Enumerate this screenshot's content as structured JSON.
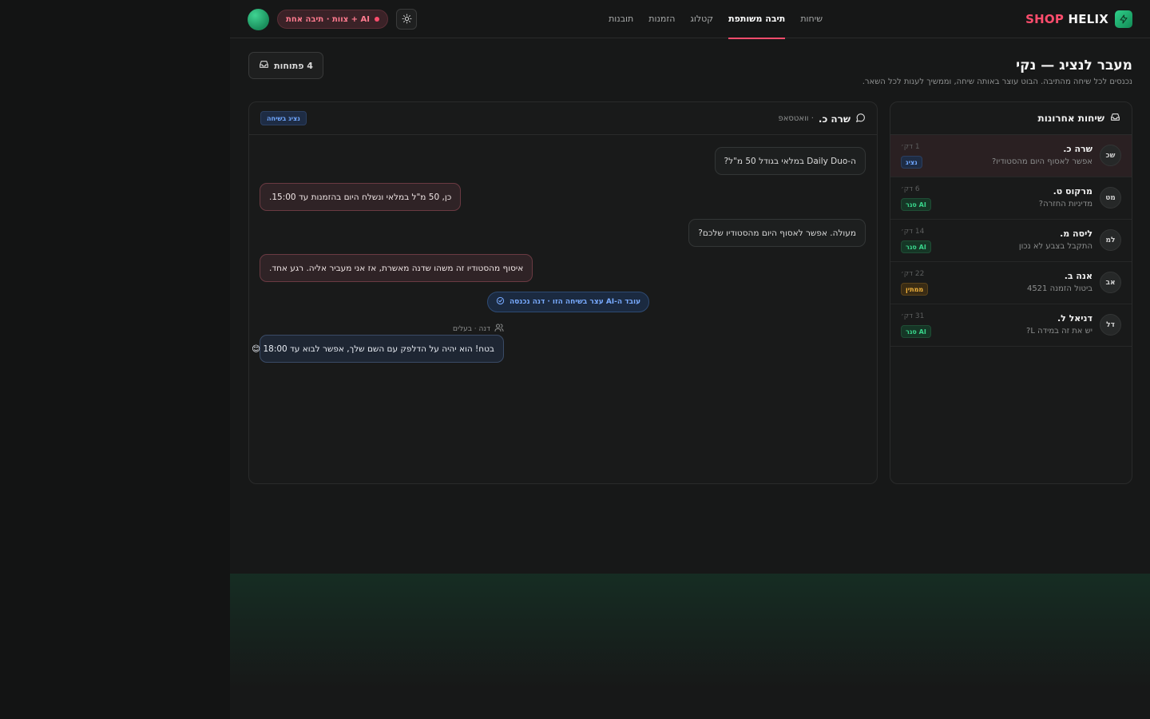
{
  "brand": {
    "shop": "SHOP",
    "helix": "HELIX",
    "icon": "bolt-icon"
  },
  "nav": {
    "items": [
      {
        "label": "שיחות"
      },
      {
        "label": "תיבה משותפת",
        "active": true
      },
      {
        "label": "קטלוג"
      },
      {
        "label": "הזמנות"
      },
      {
        "label": "תובנות"
      }
    ]
  },
  "header_controls": {
    "mode_label": "AI + צוות · תיבה אחת",
    "theme_icon": "sun-icon"
  },
  "page": {
    "title": "מעבר לנציג — נקי",
    "subtitle": "נכנסים לכל שיחה מהתיבה. הבוט עוצר באותה שיחה, וממשיך לענות לכל השאר.",
    "open_button": "4 פתוחות"
  },
  "sidebar": {
    "title": "שיחות אחרונות",
    "conversations": [
      {
        "initials": "שכ",
        "name": "שרה כ.",
        "preview": "אפשר לאסוף היום מהסטודיו?",
        "time": "1 דק׳",
        "badge": "נציג",
        "badge_color": "blue",
        "active": true
      },
      {
        "initials": "מט",
        "name": "מרקוס ט.",
        "preview": "מדיניות החזרה?",
        "time": "6 דק׳",
        "badge": "AI סגר",
        "badge_color": "green"
      },
      {
        "initials": "למ",
        "name": "ליסה מ.",
        "preview": "התקבל בצבע לא נכון",
        "time": "14 דק׳",
        "badge": "AI סגר",
        "badge_color": "green"
      },
      {
        "initials": "אב",
        "name": "אנה ב.",
        "preview": "ביטול הזמנה 4521",
        "time": "22 דק׳",
        "badge": "ממתין",
        "badge_color": "amber"
      },
      {
        "initials": "דל",
        "name": "דניאל ל.",
        "preview": "יש את זה במידה L?",
        "time": "31 דק׳",
        "badge": "AI סגר",
        "badge_color": "green"
      }
    ]
  },
  "chat": {
    "customer": "שרה כ.",
    "channel": "· וואטסאפ",
    "status": "נציג בשיחה",
    "messages": [
      {
        "type": "in",
        "text": "ה-Daily Duo במלאי בגודל 50 מ\"ל?"
      },
      {
        "type": "out",
        "text": "כן, 50 מ\"ל במלאי ונשלח היום בהזמנות עד 15:00."
      },
      {
        "type": "in",
        "text": "מעולה. אפשר לאסוף היום מהסטודיו שלכם?"
      },
      {
        "type": "out",
        "text": "איסוף מהסטודיו זה משהו שדנה מאשרת, אז אני מעביר אליה. רגע אחד."
      },
      {
        "type": "agent",
        "text": "בטח! הוא יהיה על הדלפק עם השם שלך, אפשר לבוא עד 18:00 😊"
      }
    ],
    "system_notice": "עובד ה-AI עצר בשיחה הזו · דנה נכנסה",
    "agent_label": "דנה · בעלים"
  },
  "colors": {
    "accent": "#ff4d6d",
    "brand_green": "#2fd08a",
    "agent_blue": "#6fa6ff"
  }
}
